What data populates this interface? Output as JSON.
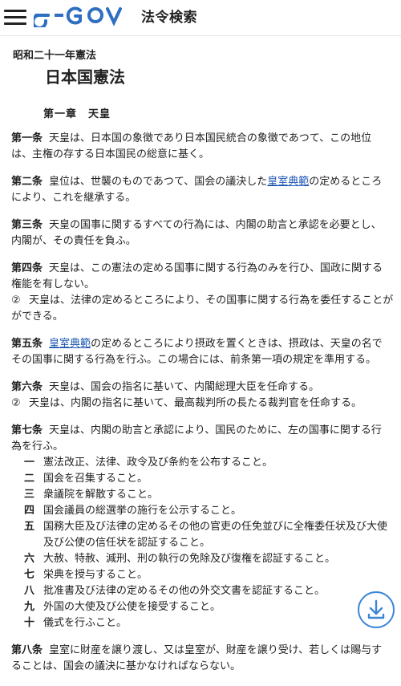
{
  "header": {
    "site_title": "法令検索",
    "logo_text": "e-GOV"
  },
  "law": {
    "era_title": "昭和二十一年憲法",
    "title": "日本国憲法",
    "chapter": "第一章　天皇"
  },
  "articles": [
    {
      "num": "第一条",
      "lines": [
        "天皇は、日本国の象徴であり日本国民統合の象徴であつて、この地位",
        "は、主権の存する日本国民の総意に基く。"
      ]
    },
    {
      "num": "第二条",
      "before": "皇位は、世襲のものであつて、国会の議決した",
      "link": "皇室典範",
      "after": "の定めるところ",
      "line2": "により、これを継承する。"
    },
    {
      "num": "第三条",
      "lines": [
        "天皇の国事に関するすべての行為には、内閣の助言と承認を必要とし、",
        "内閣が、その責任を負ふ。"
      ]
    },
    {
      "num": "第四条",
      "lines": [
        "天皇は、この憲法の定める国事に関する行為のみを行ひ、国政に関する",
        "権能を有しない。"
      ],
      "para2": {
        "num": "②",
        "lines": [
          "天皇は、法律の定めるところにより、その国事に関する行為を委任することが",
          "ができる。"
        ]
      }
    },
    {
      "num": "第五条",
      "link": "皇室典範",
      "after": "の定めるところにより摂政を置くときは、摂政は、天皇の名で",
      "line2": "その国事に関する行為を行ふ。この場合には、前条第一項の規定を準用する。"
    },
    {
      "num": "第六条",
      "lines": [
        "天皇は、国会の指名に基いて、内閣総理大臣を任命する。"
      ],
      "para2": {
        "num": "②",
        "lines": [
          "天皇は、内閣の指名に基いて、最高裁判所の長たる裁判官を任命する。"
        ]
      }
    },
    {
      "num": "第七条",
      "lines": [
        "天皇は、内閣の助言と承認により、国民のために、左の国事に関する行",
        "為を行ふ。"
      ],
      "items": [
        {
          "num": "一",
          "text": "憲法改正、法律、政令及び条約を公布すること。"
        },
        {
          "num": "二",
          "text": "国会を召集すること。"
        },
        {
          "num": "三",
          "text": "衆議院を解散すること。"
        },
        {
          "num": "四",
          "text": "国会議員の総選挙の施行を公示すること。"
        },
        {
          "num": "五",
          "text": "国務大臣及び法律の定めるその他の官吏の任免並びに全権委任状及び大使",
          "text2": "及び公使の信任状を認証すること。"
        },
        {
          "num": "六",
          "text": "大赦、特赦、減刑、刑の執行の免除及び復権を認証すること。"
        },
        {
          "num": "七",
          "text": "栄典を授与すること。"
        },
        {
          "num": "八",
          "text": "批准書及び法律の定めるその他の外交文書を認証すること。"
        },
        {
          "num": "九",
          "text": "外国の大使及び公使を接受すること。"
        },
        {
          "num": "十",
          "text": "儀式を行ふこと。"
        }
      ]
    },
    {
      "num": "第八条",
      "lines": [
        "皇室に財産を譲り渡し、又は皇室が、財産を譲り受け、若しくは賜与す",
        "ることは、国会の議決に基かなければならない。"
      ]
    }
  ],
  "colors": {
    "link": "#1a55b3",
    "logo_blue": "#2f6fc1",
    "download": "#3d86d6"
  },
  "icons": {
    "menu": "hamburger-menu-icon",
    "download": "download-icon"
  }
}
